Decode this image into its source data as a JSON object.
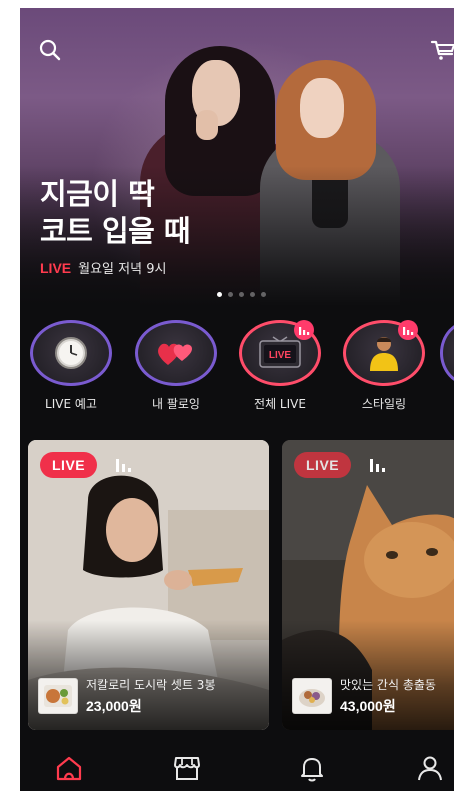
{
  "hero": {
    "title": "지금이 딱\n코트 입을 때",
    "live_tag": "LIVE",
    "schedule": "월요일 저녁 9시",
    "carousel_total": 5,
    "carousel_active": 1
  },
  "categories": [
    {
      "label": "LIVE 예고",
      "icon": "clock-icon",
      "badge": false
    },
    {
      "label": "내 팔로잉",
      "icon": "hearts-icon",
      "badge": false
    },
    {
      "label": "전체 LIVE",
      "icon": "tv-live-icon",
      "badge": true,
      "tv_text": "LIVE"
    },
    {
      "label": "스타일링",
      "icon": "person-styling-icon",
      "badge": true
    }
  ],
  "live_cards": [
    {
      "tag": "LIVE",
      "product_name": "저칼로리 도시락 셋트 3봉",
      "price": "23,000원"
    },
    {
      "tag": "LIVE",
      "product_name": "맛있는 간식 총출동",
      "price": "43,000원"
    }
  ],
  "colors": {
    "accent": "#ff3b4e",
    "badge": "#ff3b6b",
    "ring": "#7a5bd0",
    "background": "#0d0d0f"
  },
  "tabbar": {
    "active": "home",
    "items": [
      "home-icon",
      "store-icon",
      "bell-icon",
      "profile-icon"
    ]
  }
}
